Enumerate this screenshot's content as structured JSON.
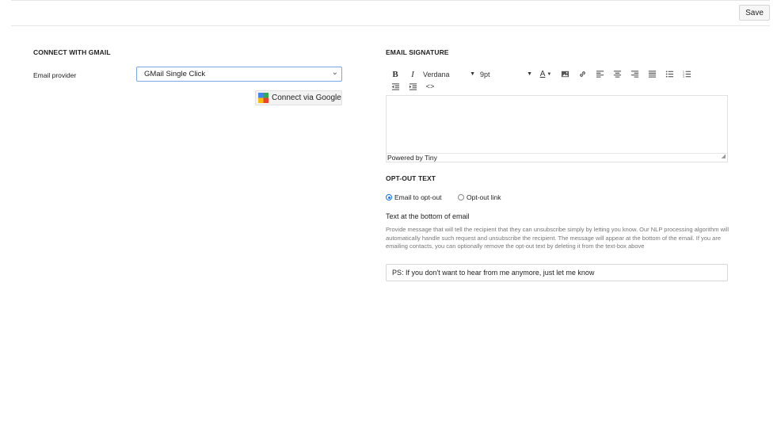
{
  "toolbar": {
    "save_label": "Save"
  },
  "gmail": {
    "title": "CONNECT WITH GMAIL",
    "provider_label": "Email provider",
    "provider_value": "GMail Single Click",
    "connect_label": "Connect via Google"
  },
  "signature": {
    "title": "EMAIL SIGNATURE",
    "font_family": "Verdana",
    "font_size": "9pt",
    "powered_by": "Powered by Tiny"
  },
  "optout": {
    "title": "OPT-OUT TEXT",
    "option_email": "Email to opt-out",
    "option_link": "Opt-out link",
    "text_label": "Text at the bottom of email",
    "help": "Provide message that will tell the recipient that they can unsubscribe simply by letting you know. Our NLP processing algorithm will automatically handle such request and unsubscribe the recipient. The message will appear at the bottom of the email. If you are emailing contacts, you can optionally remove the opt-out text by deleting it from the text-box above",
    "text_value": "PS: If you don't want to hear from me anymore, just let me know"
  },
  "colors": {
    "accent": "#1a73e8",
    "select_border": "#7aa7e6"
  }
}
